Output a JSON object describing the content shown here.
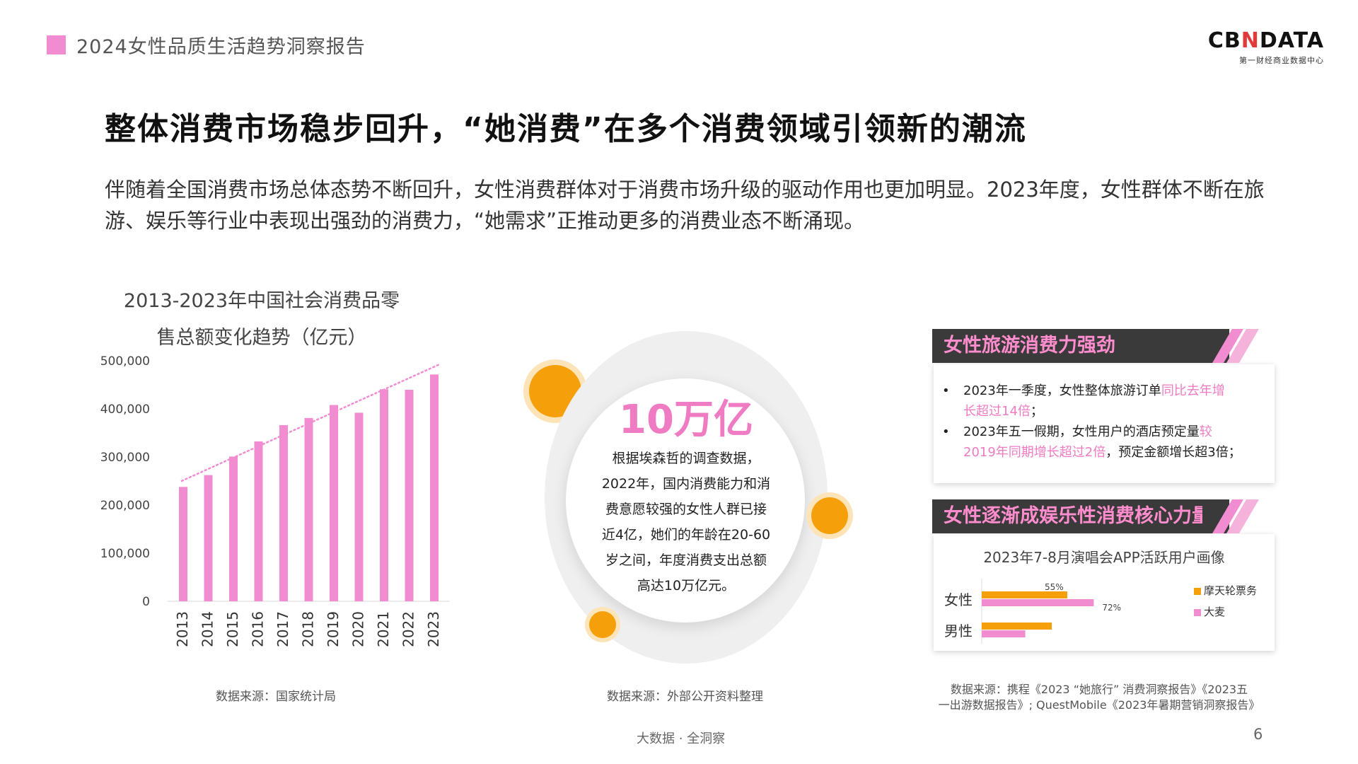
{
  "header": {
    "report_title": "2024女性品质生活趋势洞察报告",
    "logo_main_1": "CB",
    "logo_main_x": "N",
    "logo_main_2": "DATA",
    "logo_sub": "第一财经商业数据中心"
  },
  "main_title": "整体消费市场稳步回升，“她消费”在多个消费领域引领新的潮流",
  "intro": "伴随着全国消费市场总体态势不断回升，女性消费群体对于消费市场升级的驱动作用也更加明显。2023年度，女性群体不断在旅游、娱乐等行业中表现出强劲的消费力，“她需求”正推动更多的消费业态不断涌现。",
  "left_chart": {
    "title_line1": "2013-2023年中国社会消费品零",
    "title_line2": "售总额变化趋势（亿元）",
    "source": "数据来源：国家统计局"
  },
  "center": {
    "big_number": "10万亿",
    "text_lines": [
      "根据埃森哲的调查数据，",
      "2022年，国内消费能力和消",
      "费意愿较强的女性人群已接",
      "近4亿，她们的年龄在20-60",
      "岁之间，年度消费支出总额",
      "高达10万亿元。"
    ],
    "source": "数据来源：外部公开资料整理"
  },
  "panel_travel": {
    "title": "女性旅游消费力强劲",
    "bullet1_a": "2023年一季度，女性整体旅游订单",
    "bullet1_b": "同比去年增",
    "bullet1_c": "长超过14倍",
    "bullet1_d": "；",
    "bullet2_a": "2023年五一假期，女性用户的酒店预定量",
    "bullet2_b": "较",
    "bullet2_c": "2019年同期增长超过2倍",
    "bullet2_d": "，预定金额增长超3倍；"
  },
  "panel_ent": {
    "title": "女性逐渐成娱乐性消费核心力量",
    "chart_title": "2023年7-8月演唱会APP活跃用户画像"
  },
  "right_source_line1": "数据来源：携程《2023 “她旅行” 消费洞察报告》《2023五",
  "right_source_line2": "一出游数据报告》; QuestMobile《2023年暑期营销洞察报告》",
  "footer": "大数据 · 全洞察",
  "page_number": "6",
  "colors": {
    "pink": "#f08ccf",
    "orange": "#f5a00b",
    "dark": "#3a3a3a"
  },
  "chart_data": [
    {
      "type": "bar",
      "title": "2013-2023年中国社会消费品零售总额变化趋势（亿元）",
      "categories": [
        "2013",
        "2014",
        "2015",
        "2016",
        "2017",
        "2018",
        "2019",
        "2020",
        "2021",
        "2022",
        "2023"
      ],
      "values": [
        237810,
        262394,
        300931,
        332316,
        366262,
        380987,
        408017,
        391981,
        440823,
        439733,
        471495
      ],
      "yticks": [
        "500,000",
        "400,000",
        "300,000",
        "200,000",
        "100,000",
        "0"
      ],
      "ylim": [
        0,
        500000
      ],
      "trendline": "dotted linear",
      "color": "#f08ccf"
    },
    {
      "type": "bar",
      "orientation": "horizontal",
      "title": "2023年7-8月演唱会APP活跃用户画像",
      "categories": [
        "女性",
        "男性"
      ],
      "series": [
        {
          "name": "摩天轮票务",
          "color": "#f5a00b",
          "values": [
            55,
            45
          ]
        },
        {
          "name": "大麦",
          "color": "#f08ccf",
          "values": [
            72,
            28
          ]
        }
      ],
      "data_labels": {
        "女性": [
          "55%",
          "72%"
        ]
      },
      "xlim": [
        0,
        100
      ],
      "legend_position": "right"
    }
  ]
}
